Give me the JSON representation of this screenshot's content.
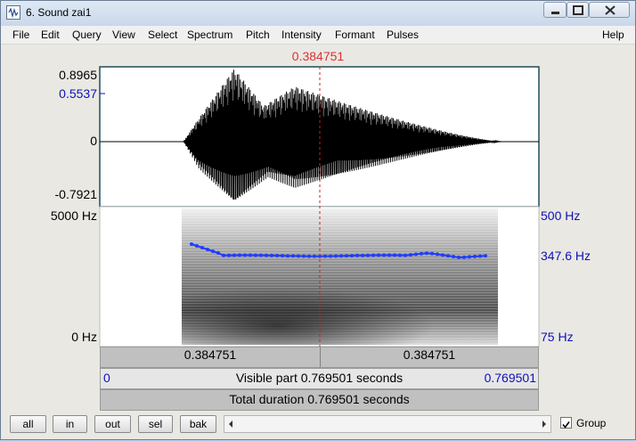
{
  "window": {
    "title": "6. Sound zai1"
  },
  "menu": [
    "File",
    "Edit",
    "Query",
    "View",
    "Select",
    "Spectrum",
    "Pitch",
    "Intensity",
    "Formant",
    "Pulses"
  ],
  "help": "Help",
  "cursor_time": "0.384751",
  "wave": {
    "y_max": "0.8965",
    "y_cursor": "0.5537",
    "y_zero": "0",
    "y_min": "-0.7921"
  },
  "spectrogram": {
    "f_max": "5000 Hz",
    "f_min": "0 Hz",
    "pitch_max": "500 Hz",
    "pitch_cursor": "347.6 Hz",
    "pitch_min": "75 Hz",
    "pitch_color": "#1f3cff"
  },
  "bars": {
    "left_segment": "0.384751",
    "right_segment": "0.384751",
    "visible_start": "0",
    "visible_label": "Visible part 0.769501 seconds",
    "visible_end": "0.769501",
    "total_label": "Total duration 0.769501 seconds"
  },
  "buttons": {
    "all": "all",
    "in": "in",
    "out": "out",
    "sel": "sel",
    "bak": "bak"
  },
  "group": {
    "label": "Group",
    "checked": true
  }
}
